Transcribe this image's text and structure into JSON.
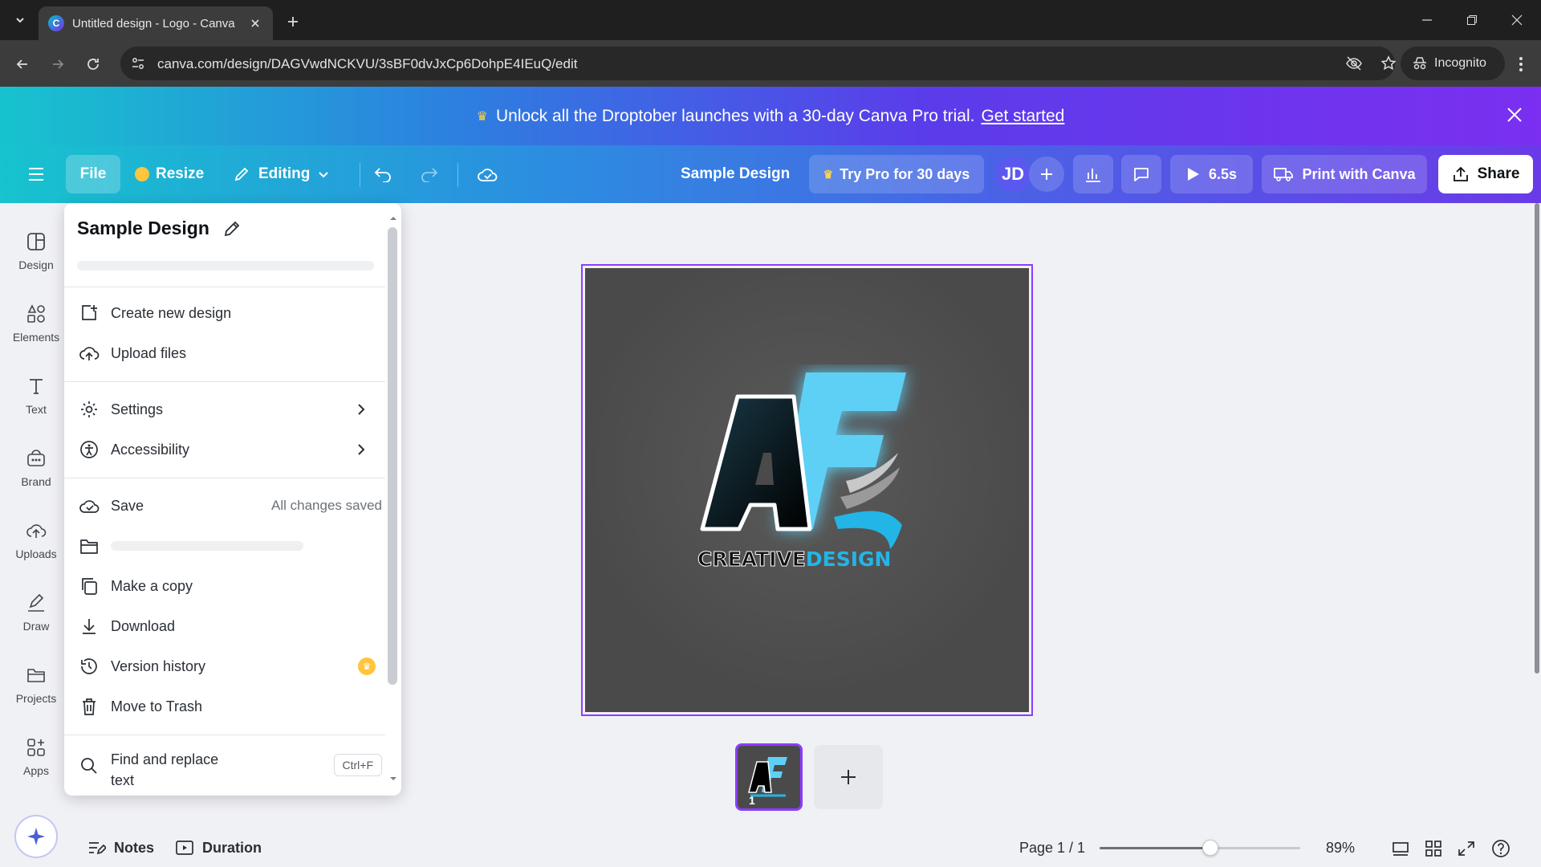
{
  "browser": {
    "tab_title": "Untitled design - Logo - Canva",
    "favicon_letter": "C",
    "url": "canva.com/design/DAGVwdNCKVU/3sBF0dvJxCp6DohpE4IEuQ/edit",
    "incognito_label": "Incognito"
  },
  "promo": {
    "message": "Unlock all the Droptober launches with a 30-day Canva Pro trial.",
    "link": "Get started",
    "crown_icon": "♛"
  },
  "header": {
    "file": "File",
    "resize": "Resize",
    "editing": "Editing",
    "design_name": "Sample Design",
    "try_pro": "Try Pro for 30 days",
    "avatar_initials": "JD",
    "play_duration": "6.5s",
    "print": "Print with Canva",
    "share": "Share"
  },
  "rail": {
    "items": [
      {
        "label": "Design",
        "icon": "design-icon"
      },
      {
        "label": "Elements",
        "icon": "elements-icon"
      },
      {
        "label": "Text",
        "icon": "text-icon"
      },
      {
        "label": "Brand",
        "icon": "brand-icon"
      },
      {
        "label": "Uploads",
        "icon": "uploads-icon"
      },
      {
        "label": "Draw",
        "icon": "draw-icon"
      },
      {
        "label": "Projects",
        "icon": "projects-icon"
      },
      {
        "label": "Apps",
        "icon": "apps-icon"
      }
    ]
  },
  "file_menu": {
    "title": "Sample Design",
    "items": {
      "create": "Create new design",
      "upload": "Upload files",
      "settings": "Settings",
      "accessibility": "Accessibility",
      "save": "Save",
      "save_status": "All changes saved",
      "copy": "Make a copy",
      "download": "Download",
      "version": "Version history",
      "trash": "Move to Trash",
      "find": "Find and replace text",
      "find_shortcut": "Ctrl+F"
    }
  },
  "canvas": {
    "logo_text_white": "CREATIVE",
    "logo_text_blue": "DESIGN",
    "page_number": "1"
  },
  "footer": {
    "notes": "Notes",
    "duration": "Duration",
    "page_indicator": "Page 1 / 1",
    "zoom": "89%",
    "zoom_level": 0.55
  },
  "colors": {
    "accent": "#8b3dff",
    "promo_start": "#17c3ce",
    "promo_end": "#7b2ff0",
    "logo_blue": "#5fd0f5"
  }
}
